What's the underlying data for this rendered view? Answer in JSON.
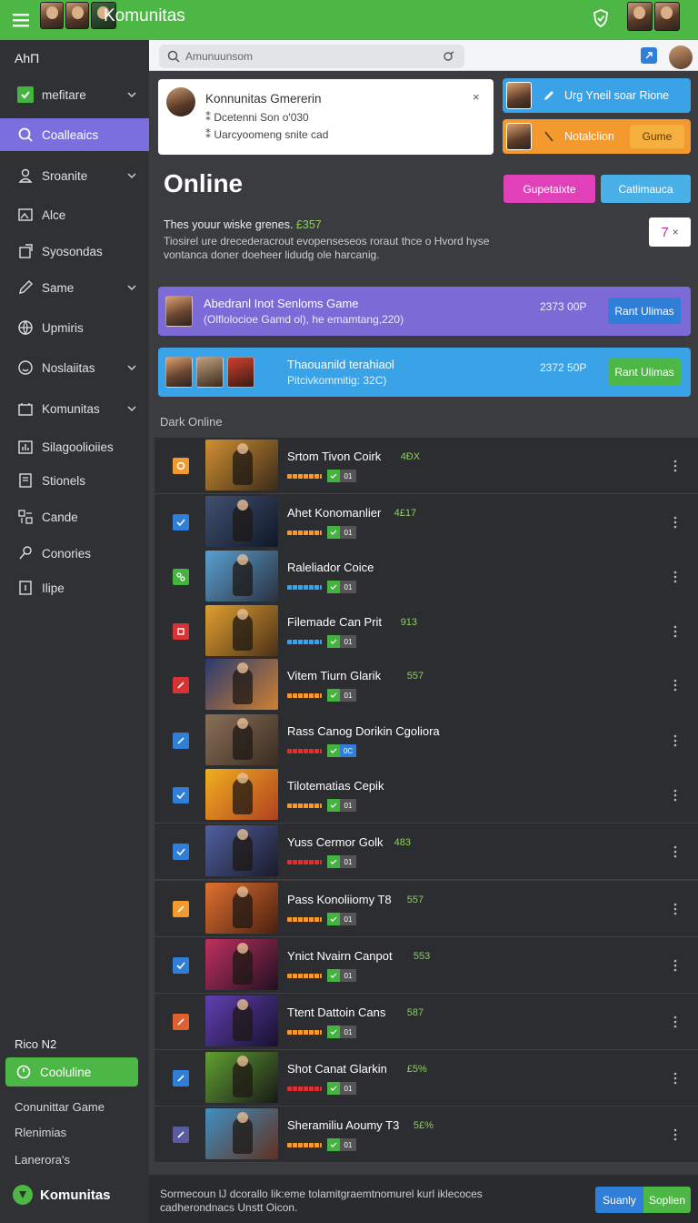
{
  "app": {
    "title": "Komunitas"
  },
  "colors": {
    "accent": "#4cb744",
    "active_nav": "#7b6fe0",
    "pink": "#e040b8",
    "cyan": "#4ab0e8",
    "blue": "#2f7fd8",
    "orange": "#f29a2e"
  },
  "sidebar": {
    "header": "AhΠ",
    "items": [
      {
        "label": "mefitare",
        "icon": "checkbox-icon",
        "chevron": true
      },
      {
        "label": "Coalleaics",
        "icon": "search-icon",
        "active": true
      },
      {
        "label": "Sroanite",
        "icon": "user-icon",
        "chevron": true
      },
      {
        "label": "Alce",
        "icon": "image-icon"
      },
      {
        "label": "Syosondas",
        "icon": "share-icon"
      },
      {
        "label": "Same",
        "icon": "pencil-icon",
        "chevron": true
      },
      {
        "label": "Upmiris",
        "icon": "globe-icon"
      },
      {
        "label": "Noslaiitas",
        "icon": "smile-icon",
        "chevron": true
      },
      {
        "label": "Komunitas",
        "icon": "folder-icon",
        "chevron": true
      },
      {
        "label": "Silagoolioiies",
        "icon": "chart-icon"
      },
      {
        "label": "Stionels",
        "icon": "document-icon"
      },
      {
        "label": "Cande",
        "icon": "grid-icon"
      },
      {
        "label": "Conories",
        "icon": "key-icon"
      },
      {
        "label": "Ilipe",
        "icon": "file-icon"
      }
    ],
    "bottom_header": "Rico N2",
    "online_button": "Cooluline",
    "footer_links": [
      "Conunittar Game",
      "Rlenimias",
      "Lanerora's"
    ],
    "brand": "Komunitas"
  },
  "search": {
    "placeholder": "Amunuunsom"
  },
  "notification": {
    "title": "Konnunitas Gmererin",
    "line1": "Dcetenni Son o'030",
    "line2": "Uarcyoomeng snite cad",
    "close": "×"
  },
  "promos": [
    {
      "label": "Urg Yneil soar Rione",
      "color": "#3aa2e6"
    },
    {
      "label": "Notalclion",
      "button": "Gume",
      "color": "#f29a2e"
    }
  ],
  "main": {
    "heading": "Online",
    "btn_pink": "Gupetaixte",
    "btn_cyan": "Catlimauca",
    "desc_lead": "Thes youur wiske grenes.",
    "desc_highlight": "£357",
    "desc_body": "Tiosirel ure drecederacrout evopenseseos roraut thce o Hvord hyse vontanca doner doeheer lidudg ole harcanig.",
    "counter_value": "7",
    "counter_close": "×"
  },
  "featured": [
    {
      "title": "Abedranl Inot Senloms Game",
      "subtitle": "(Olflolocioe Gamd ol), he emamtang,220)",
      "price": "2373 00P",
      "button": "Rant Ulimas",
      "color": "#7c6ad6"
    },
    {
      "title": "Thaouanild terahiaol",
      "subtitle": "Pitcivkommitig: 32C)",
      "price": "2372 50P",
      "button": "Rant Ulimas",
      "color": "#3aa2e6"
    }
  ],
  "list_label": "Dark Online",
  "games": [
    {
      "name": "Srtom Tivon Coirk",
      "tag": "4ĐX",
      "chk_color": "#f29a2e",
      "chk_icon": "circle",
      "bar_color": "#f29a2e",
      "chip": "01",
      "thumb": [
        "#d09030",
        "#3a2a1a"
      ]
    },
    {
      "name": "Ahet Konomanlier",
      "tag": "4£17",
      "chk_color": "#2f7fd8",
      "chk_icon": "check",
      "bar_color": "#f29a2e",
      "chip": "01",
      "thumb": [
        "#405070",
        "#101828"
      ]
    },
    {
      "name": "Raleliador Coice",
      "tag": "",
      "chk_color": "#44b340",
      "chk_icon": "cross",
      "bar_color": "#3aa2e6",
      "chip": "01",
      "thumb": [
        "#5aa0d0",
        "#2a3040"
      ]
    },
    {
      "name": "Filemade Can Prit",
      "tag": "913",
      "chk_color": "#d83232",
      "chk_icon": "square",
      "bar_color": "#3aa2e6",
      "chip": "01",
      "thumb": [
        "#e0a030",
        "#4a3018"
      ]
    },
    {
      "name": "Vitem Tiurn Glarik",
      "tag": "557",
      "chk_color": "#d83232",
      "chk_icon": "slash",
      "bar_color": "#f29a2e",
      "chip": "01",
      "thumb": [
        "#2a3a70",
        "#d08030"
      ]
    },
    {
      "name": "Rass Canog Dorikin Cgoliora",
      "tag": "",
      "chk_color": "#2f7fd8",
      "chk_icon": "slash",
      "bar_color": "#d83232",
      "chip": "0C",
      "thumb": [
        "#8a7058",
        "#3a2c20"
      ]
    },
    {
      "name": "Tilotematias Cepik",
      "tag": "",
      "chk_color": "#2f7fd8",
      "chk_icon": "check",
      "bar_color": "#f29a2e",
      "chip": "01",
      "thumb": [
        "#f0b020",
        "#b04020"
      ]
    },
    {
      "name": "Yuss Cermor Golk",
      "tag": "483",
      "chk_color": "#2f7fd8",
      "chk_icon": "check",
      "bar_color": "#d83232",
      "chip": "01",
      "thumb": [
        "#5060a0",
        "#1a1a28"
      ]
    },
    {
      "name": "Pass Konoliiomy T8",
      "tag": "557",
      "chk_color": "#f29a2e",
      "chk_icon": "slash",
      "bar_color": "#f29a2e",
      "chip": "01",
      "thumb": [
        "#e07030",
        "#4a2010"
      ]
    },
    {
      "name": "Ynict Nvairn Canpot",
      "tag": "553",
      "chk_color": "#2f7fd8",
      "chk_icon": "check",
      "bar_color": "#f29a2e",
      "chip": "01",
      "thumb": [
        "#c03060",
        "#201020"
      ]
    },
    {
      "name": "Ttent Dattoin Cans",
      "tag": "587",
      "chk_color": "#e06030",
      "chk_icon": "slash",
      "bar_color": "#f29a2e",
      "chip": "01",
      "thumb": [
        "#6040b0",
        "#181030"
      ]
    },
    {
      "name": "Shot Canat Glarkin",
      "tag": "£5%",
      "chk_color": "#2f7fd8",
      "chk_icon": "slash",
      "bar_color": "#d83232",
      "chip": "01",
      "thumb": [
        "#60a030",
        "#181818"
      ]
    },
    {
      "name": "Sheramiliu Aoumy T3",
      "tag": "5£%",
      "chk_color": "#5a5aa0",
      "chk_icon": "slash",
      "bar_color": "#f29a2e",
      "chip": "01",
      "thumb": [
        "#4090c0",
        "#603020"
      ]
    }
  ],
  "statusbar": {
    "text": "Sormecoun lJ dcorallo lik:eme tolamitgraemtnomurel kurl iklecoces cadherondnacs Unstt Oicon.",
    "btn1": "Suanly",
    "btn2": "Soplien"
  }
}
